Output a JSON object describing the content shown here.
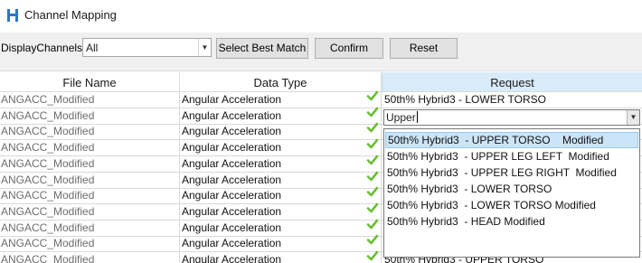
{
  "window": {
    "title": "Channel Mapping",
    "icon": "hyperworks-logo-icon"
  },
  "toolbar": {
    "display_label": "DisplayChannels",
    "display_value": "All",
    "best_match_label": "Select Best Match",
    "confirm_label": "Confirm",
    "reset_label": "Reset"
  },
  "columns": {
    "file": "File Name",
    "type": "Data Type",
    "request": "Request"
  },
  "rows": [
    {
      "file": "ANGACC_Modified",
      "type": "Angular Acceleration",
      "request": "50th% Hybrid3  - LOWER TORSO",
      "checked": true
    },
    {
      "file": "ANGACC_Modified",
      "type": "Angular Acceleration",
      "request": "",
      "checked": true
    },
    {
      "file": "ANGACC_Modified",
      "type": "Angular Acceleration",
      "request": "",
      "checked": true
    },
    {
      "file": "ANGACC_Modified",
      "type": "Angular Acceleration",
      "request": "",
      "checked": true
    },
    {
      "file": "ANGACC_Modified",
      "type": "Angular Acceleration",
      "request": "",
      "checked": true
    },
    {
      "file": "ANGACC_Modified",
      "type": "Angular Acceleration",
      "request": "",
      "checked": true
    },
    {
      "file": "ANGACC_Modified",
      "type": "Angular Acceleration",
      "request": "",
      "checked": true
    },
    {
      "file": "ANGACC_Modified",
      "type": "Angular Acceleration",
      "request": "",
      "checked": true
    },
    {
      "file": "ANGACC_Modified",
      "type": "Angular Acceleration",
      "request": "",
      "checked": true
    },
    {
      "file": "ANGACC_Modified",
      "type": "Angular Acceleration",
      "request": "",
      "checked": true
    },
    {
      "file": "ANGACC_Modified",
      "type": "Angular Acceleration",
      "request": "50th% Hybrid3  - UPPER TORSO",
      "checked": true
    }
  ],
  "editor": {
    "value": "Upper"
  },
  "dropdown": {
    "options": [
      "50th% Hybrid3  - UPPER TORSO    Modified",
      "50th% Hybrid3  - UPPER LEG LEFT  Modified",
      "50th% Hybrid3  - UPPER LEG RIGHT  Modified",
      "50th% Hybrid3  - LOWER TORSO",
      "50th% Hybrid3  - LOWER TORSO Modified",
      "50th% Hybrid3  - HEAD Modified"
    ],
    "selected_index": 0
  },
  "colors": {
    "header_highlight": "#d9ebf9",
    "selection": "#cce4f7",
    "check": "#6abf3a"
  }
}
